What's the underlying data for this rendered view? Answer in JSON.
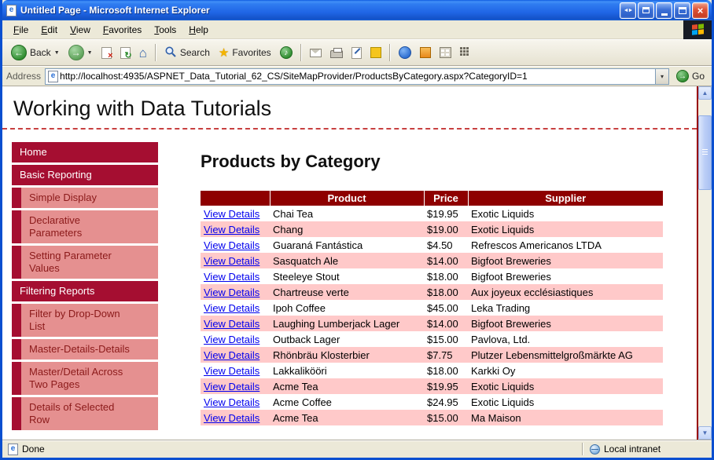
{
  "window": {
    "title": "Untitled Page - Microsoft Internet Explorer",
    "status_left": "Done",
    "status_right": "Local intranet"
  },
  "menu": {
    "items": [
      "File",
      "Edit",
      "View",
      "Favorites",
      "Tools",
      "Help"
    ]
  },
  "toolbar": {
    "back_label": "Back",
    "search_label": "Search",
    "favorites_label": "Favorites"
  },
  "address": {
    "label": "Address",
    "url": "http://localhost:4935/ASPNET_Data_Tutorial_62_CS/SiteMapProvider/ProductsByCategory.aspx?CategoryID=1",
    "go_label": "Go"
  },
  "page": {
    "site_title": "Working with Data Tutorials",
    "heading": "Products by Category"
  },
  "sidebar": {
    "items": [
      {
        "label": "Home",
        "level": 0
      },
      {
        "label": "Basic Reporting",
        "level": 0
      },
      {
        "label": "Simple Display",
        "level": 1
      },
      {
        "label": "Declarative Parameters",
        "level": 1
      },
      {
        "label": "Setting Parameter Values",
        "level": 1
      },
      {
        "label": "Filtering Reports",
        "level": 0
      },
      {
        "label": "Filter by Drop-Down List",
        "level": 1
      },
      {
        "label": "Master-Details-Details",
        "level": 1
      },
      {
        "label": "Master/Detail Across Two Pages",
        "level": 1
      },
      {
        "label": "Details of Selected Row",
        "level": 1
      }
    ]
  },
  "table": {
    "headers": [
      "",
      "Product",
      "Price",
      "Supplier"
    ],
    "link_label": "View Details",
    "rows": [
      {
        "product": "Chai Tea",
        "price": "$19.95",
        "supplier": "Exotic Liquids"
      },
      {
        "product": "Chang",
        "price": "$19.00",
        "supplier": "Exotic Liquids"
      },
      {
        "product": "Guaraná Fantástica",
        "price": "$4.50",
        "supplier": "Refrescos Americanos LTDA"
      },
      {
        "product": "Sasquatch Ale",
        "price": "$14.00",
        "supplier": "Bigfoot Breweries"
      },
      {
        "product": "Steeleye Stout",
        "price": "$18.00",
        "supplier": "Bigfoot Breweries"
      },
      {
        "product": "Chartreuse verte",
        "price": "$18.00",
        "supplier": "Aux joyeux ecclésiastiques"
      },
      {
        "product": "Ipoh Coffee",
        "price": "$45.00",
        "supplier": "Leka Trading"
      },
      {
        "product": "Laughing Lumberjack Lager",
        "price": "$14.00",
        "supplier": "Bigfoot Breweries"
      },
      {
        "product": "Outback Lager",
        "price": "$15.00",
        "supplier": "Pavlova, Ltd."
      },
      {
        "product": "Rhönbräu Klosterbier",
        "price": "$7.75",
        "supplier": "Plutzer Lebensmittelgroßmärkte AG"
      },
      {
        "product": "Lakkalikööri",
        "price": "$18.00",
        "supplier": "Karkki Oy"
      },
      {
        "product": "Acme Tea",
        "price": "$19.95",
        "supplier": "Exotic Liquids"
      },
      {
        "product": "Acme Coffee",
        "price": "$24.95",
        "supplier": "Exotic Liquids"
      },
      {
        "product": "Acme Tea",
        "price": "$15.00",
        "supplier": "Ma Maison"
      }
    ]
  },
  "icons": {
    "ie_e": "e",
    "left_right": "◄►",
    "close_x": "×",
    "back_arrow": "←",
    "forward_arrow": "→",
    "stop_x": "×",
    "refresh_arrows": "↻",
    "home": "⌂",
    "favorites_star": "★",
    "media_note": "♪",
    "go_arrow": "→",
    "dropdown_caret": "▼",
    "address_caret": "▾",
    "scroll_up": "▲",
    "scroll_down": "▼"
  },
  "colors": {
    "nav_top_bg": "#A50E31",
    "nav_sub_bg": "#E59090",
    "nav_sub_text": "#8B1A1A",
    "table_header_bg": "#8E0000",
    "alt_row_bg": "#FFC9C9",
    "link_blue": "#0000EE",
    "titlebar_blue": "#2066E6",
    "chrome_bg": "#ECE9D8"
  }
}
